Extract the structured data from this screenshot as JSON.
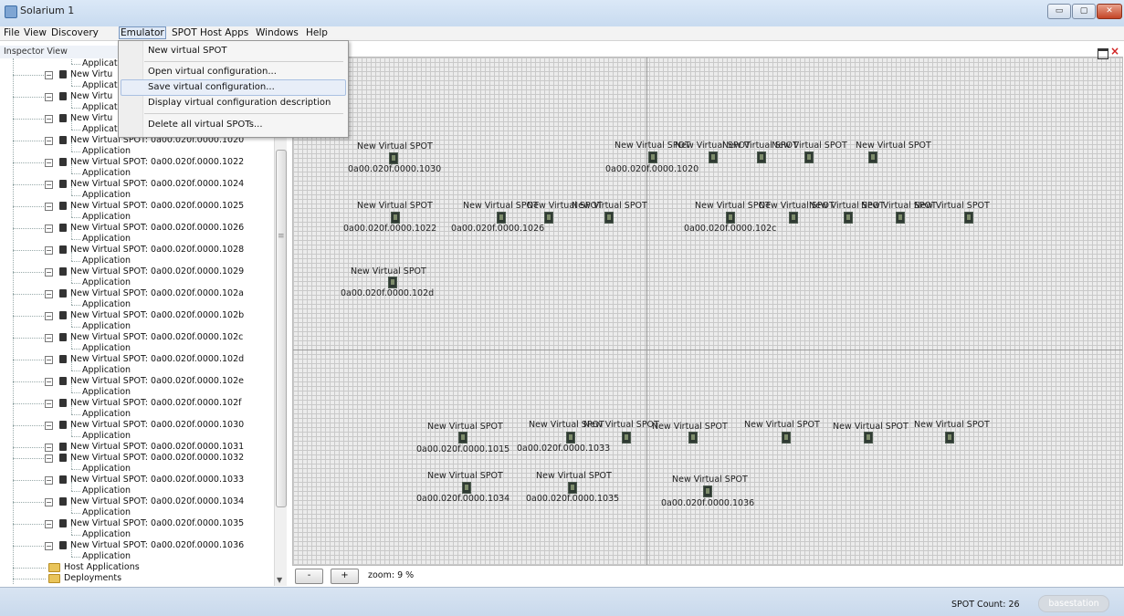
{
  "window": {
    "title": "Solarium 1",
    "min_btn": "▭",
    "max_btn": "▢",
    "close_btn": "✕"
  },
  "menubar": {
    "items": [
      "File",
      "View",
      "Discovery",
      "Emulator",
      "SPOT Host Apps",
      "Windows",
      "Help"
    ]
  },
  "emulator_menu": {
    "items": [
      "New virtual SPOT",
      "Open virtual configuration...",
      "Save virtual configuration...",
      "Display virtual configuration description",
      "Delete all virtual SPOTs..."
    ],
    "highlighted": "Save virtual configuration..."
  },
  "inspector": {
    "title": "Inspector View",
    "tree": [
      {
        "label": "Applicati",
        "type": "application"
      },
      {
        "label": "New Virtu",
        "type": "spot"
      },
      {
        "label": "Applicati",
        "type": "application"
      },
      {
        "label": "New Virtu",
        "type": "spot"
      },
      {
        "label": "Applicati",
        "type": "application"
      },
      {
        "label": "New Virtu",
        "type": "spot"
      },
      {
        "label": "Applicati",
        "type": "application"
      },
      {
        "label": "New Virtual SPOT: 0a00.020f.0000.1020",
        "type": "spot"
      },
      {
        "label": "Application",
        "type": "application"
      },
      {
        "label": "New Virtual SPOT: 0a00.020f.0000.1022",
        "type": "spot"
      },
      {
        "label": "Application",
        "type": "application"
      },
      {
        "label": "New Virtual SPOT: 0a00.020f.0000.1024",
        "type": "spot"
      },
      {
        "label": "Application",
        "type": "application"
      },
      {
        "label": "New Virtual SPOT: 0a00.020f.0000.1025",
        "type": "spot"
      },
      {
        "label": "Application",
        "type": "application"
      },
      {
        "label": "New Virtual SPOT: 0a00.020f.0000.1026",
        "type": "spot"
      },
      {
        "label": "Application",
        "type": "application"
      },
      {
        "label": "New Virtual SPOT: 0a00.020f.0000.1028",
        "type": "spot"
      },
      {
        "label": "Application",
        "type": "application"
      },
      {
        "label": "New Virtual SPOT: 0a00.020f.0000.1029",
        "type": "spot"
      },
      {
        "label": "Application",
        "type": "application"
      },
      {
        "label": "New Virtual SPOT: 0a00.020f.0000.102a",
        "type": "spot"
      },
      {
        "label": "Application",
        "type": "application"
      },
      {
        "label": "New Virtual SPOT: 0a00.020f.0000.102b",
        "type": "spot"
      },
      {
        "label": "Application",
        "type": "application"
      },
      {
        "label": "New Virtual SPOT: 0a00.020f.0000.102c",
        "type": "spot"
      },
      {
        "label": "Application",
        "type": "application"
      },
      {
        "label": "New Virtual SPOT: 0a00.020f.0000.102d",
        "type": "spot"
      },
      {
        "label": "Application",
        "type": "application"
      },
      {
        "label": "New Virtual SPOT: 0a00.020f.0000.102e",
        "type": "spot"
      },
      {
        "label": "Application",
        "type": "application"
      },
      {
        "label": "New Virtual SPOT: 0a00.020f.0000.102f",
        "type": "spot"
      },
      {
        "label": "Application",
        "type": "application"
      },
      {
        "label": "New Virtual SPOT: 0a00.020f.0000.1030",
        "type": "spot"
      },
      {
        "label": "Application",
        "type": "application"
      },
      {
        "label": "New Virtual SPOT: 0a00.020f.0000.1031",
        "type": "spot"
      },
      {
        "label": "New Virtual SPOT: 0a00.020f.0000.1032",
        "type": "spot"
      },
      {
        "label": "Application",
        "type": "application"
      },
      {
        "label": "New Virtual SPOT: 0a00.020f.0000.1033",
        "type": "spot"
      },
      {
        "label": "Application",
        "type": "application"
      },
      {
        "label": "New Virtual SPOT: 0a00.020f.0000.1034",
        "type": "spot"
      },
      {
        "label": "Application",
        "type": "application"
      },
      {
        "label": "New Virtual SPOT: 0a00.020f.0000.1035",
        "type": "spot"
      },
      {
        "label": "Application",
        "type": "application"
      },
      {
        "label": "New Virtual SPOT: 0a00.020f.0000.1036",
        "type": "spot"
      },
      {
        "label": "Application",
        "type": "application"
      },
      {
        "label": "Host Applications",
        "type": "folder"
      },
      {
        "label": "Deployments",
        "type": "folder"
      }
    ]
  },
  "canvas": {
    "spot_name": "New Virtual SPOT",
    "spots": [
      "0a00.020f.0000.1030",
      "0a00.020f.0000.1020",
      "0a00.020f.0000.1022",
      "0a00.020f.0000.1026",
      "0a00.020f.0000.102c",
      "0a00.020f.0000.102d",
      "0a00.020f.0000.1015",
      "0a00.020f.0000.1033",
      "0a00.020f.0000.1034",
      "0a00.020f.0000.1035",
      "0a00.020f.0000.1036"
    ],
    "overlap_clusters": [
      {
        "names": [
          "New Virtual SPOT",
          "New Virtual SPOT",
          "New Virtual SPOT",
          "New Virtual SPOT"
        ],
        "addr": "0a00.020f.0000.1020"
      },
      {
        "names": [
          "New Virtual SPOT",
          "New Virtual SPOT",
          "New Virtual SPOT"
        ],
        "addr": "0a00.020f.0000.1026"
      },
      {
        "names": [
          "New Virtual SPOT",
          "New Virtual SPOT",
          "New Virtual SPOT",
          "New Virtual SPOT",
          "New Virtual SPOT"
        ],
        "addr": "0a00.020f.0000.102c"
      },
      {
        "names": [
          "New Virtual SPOT",
          "New Virtual SPOT",
          "New Virtual SPOT",
          "New Virtual SPOT",
          "New Virtual SPOT",
          "New Virtual SPOT"
        ],
        "addr": "0a00.020f.0000.1033"
      }
    ]
  },
  "zoom": {
    "minus": "-",
    "plus": "+",
    "label": "zoom: 9 %"
  },
  "status": {
    "spot_count": "SPOT Count: 26",
    "basestation": "basestation"
  }
}
